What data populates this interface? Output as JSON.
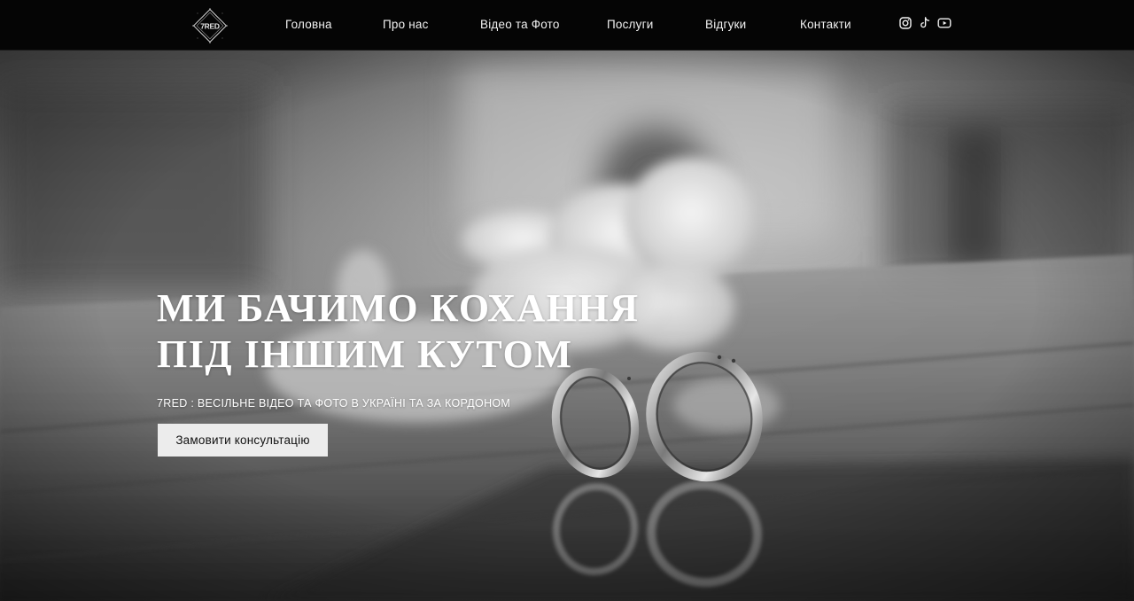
{
  "header": {
    "logo_text": "7RED",
    "nav": [
      {
        "id": "home",
        "label": "Головна"
      },
      {
        "id": "about",
        "label": "Про нас"
      },
      {
        "id": "video-photo",
        "label": "Відео та Фото"
      },
      {
        "id": "services",
        "label": "Послуги"
      },
      {
        "id": "reviews",
        "label": "Відгуки"
      },
      {
        "id": "contacts",
        "label": "Контакти"
      }
    ],
    "social": [
      {
        "name": "instagram-icon"
      },
      {
        "name": "tiktok-icon"
      },
      {
        "name": "youtube-icon"
      }
    ]
  },
  "hero": {
    "title_line1": "МИ БАЧИМО КОХАННЯ",
    "title_line2": "ПІД ІНШИМ КУТОМ",
    "subtitle": "7RED : ВЕСІЛЬНЕ ВІДЕО ТА ФОТО В УКРАЇНІ ТА ЗА КОРДОНОМ",
    "cta_label": "Замовити консультацію",
    "background": "black-and-white photo of two wedding rings on a reflective table with white flowers"
  },
  "colors": {
    "header_bg": "#050505",
    "text_light": "#f2f2f2",
    "button_bg": "#ececec",
    "button_text": "#111111"
  }
}
